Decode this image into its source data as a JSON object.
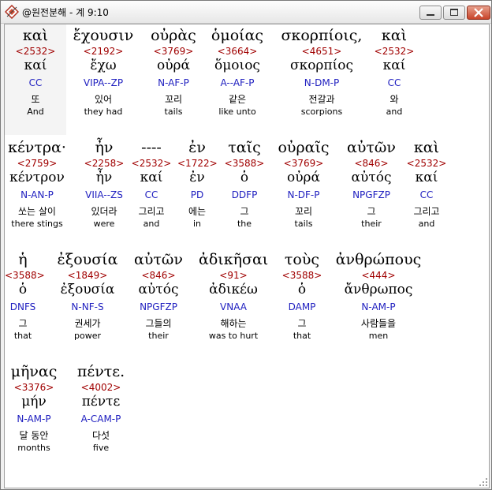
{
  "window": {
    "title": "@원전분해 - 계 9:10",
    "buttons": [
      "minimize",
      "maximize",
      "close"
    ]
  },
  "colors": {
    "strongs": "#a00000",
    "parsing": "#2020c0",
    "text": "#000000"
  },
  "rows": [
    [
      {
        "greek": "καὶ",
        "strongs": "<2532>",
        "lexeme": "καί",
        "parsing": "CC",
        "korean": "또",
        "english": "And"
      },
      {
        "greek": "ἔχουσιν",
        "strongs": "<2192>",
        "lexeme": "ἔχω",
        "parsing": "VIPA--ZP",
        "korean": "있어",
        "english": "they had"
      },
      {
        "greek": "οὐρὰς",
        "strongs": "<3769>",
        "lexeme": "οὐρά",
        "parsing": "N-AF-P",
        "korean": "꼬리",
        "english": "tails"
      },
      {
        "greek": "ὁμοίας",
        "strongs": "<3664>",
        "lexeme": "ὅμοιος",
        "parsing": "A--AF-P",
        "korean": "같은",
        "english": "like unto"
      },
      {
        "greek": "σκορπίοις,",
        "strongs": "<4651>",
        "lexeme": "σκορπίος",
        "parsing": "N-DM-P",
        "korean": "전갈과",
        "english": "scorpions"
      },
      {
        "greek": "καὶ",
        "strongs": "<2532>",
        "lexeme": "καί",
        "parsing": "CC",
        "korean": "와",
        "english": "and"
      }
    ],
    [
      {
        "greek": "κέντρα·",
        "strongs": "<2759>",
        "lexeme": "κέντρον",
        "parsing": "N-AN-P",
        "korean": "쏘는 살이",
        "english": "there stings"
      },
      {
        "greek": "ἦν",
        "strongs": "<2258>",
        "lexeme": "ἦν",
        "parsing": "VIIA--ZS",
        "korean": "있더라",
        "english": "were"
      },
      {
        "greek": "----",
        "strongs": "<2532>",
        "lexeme": "καί",
        "parsing": "CC",
        "korean": "그리고",
        "english": "and"
      },
      {
        "greek": "ἐν",
        "strongs": "<1722>",
        "lexeme": "ἐν",
        "parsing": "PD",
        "korean": "에는",
        "english": "in"
      },
      {
        "greek": "ταῖς",
        "strongs": "<3588>",
        "lexeme": "ὁ",
        "parsing": "DDFP",
        "korean": "그",
        "english": "the"
      },
      {
        "greek": "οὐραῖς",
        "strongs": "<3769>",
        "lexeme": "οὐρά",
        "parsing": "N-DF-P",
        "korean": "꼬리",
        "english": "tails"
      },
      {
        "greek": "αὐτῶν",
        "strongs": "<846>",
        "lexeme": "αὐτός",
        "parsing": "NPGFZP",
        "korean": "그",
        "english": "their"
      },
      {
        "greek": "καὶ",
        "strongs": "<2532>",
        "lexeme": "καί",
        "parsing": "CC",
        "korean": "그리고",
        "english": "and"
      }
    ],
    [
      {
        "greek": "ἡ",
        "strongs": "<3588>",
        "lexeme": "ὁ",
        "parsing": "DNFS",
        "korean": "그",
        "english": "that"
      },
      {
        "greek": "ἐξουσία",
        "strongs": "<1849>",
        "lexeme": "ἐξουσία",
        "parsing": "N-NF-S",
        "korean": "권세가",
        "english": "power"
      },
      {
        "greek": "αὐτῶν",
        "strongs": "<846>",
        "lexeme": "αὐτός",
        "parsing": "NPGFZP",
        "korean": "그들의",
        "english": "their"
      },
      {
        "greek": "ἀδικῆσαι",
        "strongs": "<91>",
        "lexeme": "ἀδικέω",
        "parsing": "VNAA",
        "korean": "해하는",
        "english": "was to hurt"
      },
      {
        "greek": "τοὺς",
        "strongs": "<3588>",
        "lexeme": "ὁ",
        "parsing": "DAMP",
        "korean": "그",
        "english": "that"
      },
      {
        "greek": "ἀνθρώπους",
        "strongs": "<444>",
        "lexeme": "ἄνθρωπος",
        "parsing": "N-AM-P",
        "korean": "사람들을",
        "english": "men"
      }
    ],
    [
      {
        "greek": "μῆνας",
        "strongs": "<3376>",
        "lexeme": "μήν",
        "parsing": "N-AM-P",
        "korean": "달 동안",
        "english": "months"
      },
      {
        "greek": "πέντε.",
        "strongs": "<4002>",
        "lexeme": "πέντε",
        "parsing": "A-CAM-P",
        "korean": "다섯",
        "english": "five"
      }
    ]
  ]
}
